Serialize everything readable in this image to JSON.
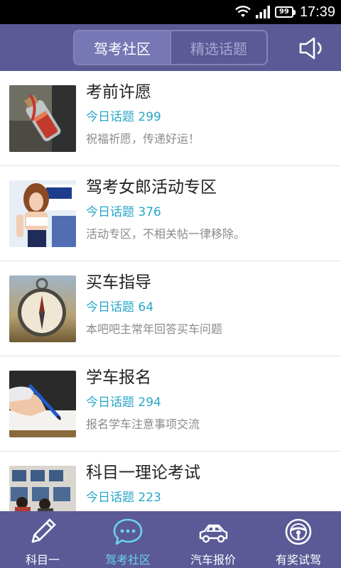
{
  "status_bar": {
    "time": "17:39",
    "battery": "99"
  },
  "header": {
    "tabs": [
      {
        "label": "驾考社区",
        "active": true
      },
      {
        "label": "精选话题",
        "active": false
      }
    ],
    "volume_icon": "speaker-icon"
  },
  "list": {
    "items": [
      {
        "title": "考前许愿",
        "count": "今日话题 299",
        "desc": "祝福祈愿，传递好运！",
        "thumb": "wish-bottle-image"
      },
      {
        "title": "驾考女郎活动专区",
        "count": "今日话题 376",
        "desc": "活动专区，不相关帖一律移除。",
        "thumb": "model-girl-image"
      },
      {
        "title": "买车指导",
        "count": "今日话题 64",
        "desc": "本吧吧主常年回答买车问题",
        "thumb": "compass-image"
      },
      {
        "title": "学车报名",
        "count": "今日话题 294",
        "desc": "报名学车注意事项交流",
        "thumb": "writing-hand-image"
      },
      {
        "title": "科目一理论考试",
        "count": "今日话题 223",
        "desc": "",
        "thumb": "exam-room-image"
      }
    ]
  },
  "bottom_nav": {
    "items": [
      {
        "label": "科目一",
        "icon": "pencil-icon",
        "active": false
      },
      {
        "label": "驾考社区",
        "icon": "chat-bubble-icon",
        "active": true
      },
      {
        "label": "汽车报价",
        "icon": "car-icon",
        "active": false
      },
      {
        "label": "有奖试驾",
        "icon": "steering-wheel-icon",
        "active": false
      }
    ]
  },
  "colors": {
    "header_bg": "#5b5a96",
    "accent": "#27a7c8",
    "active_nav": "#6ad3f2"
  }
}
